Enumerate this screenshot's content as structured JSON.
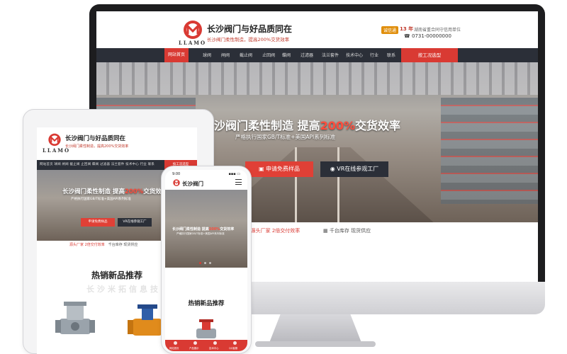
{
  "desktop": {
    "brand_word": "LLAMO",
    "title": "长沙阀门与好品质同在",
    "subtitle": "长沙阀门柔性制造，提高200%交货效率",
    "badge": "诚信通",
    "years": "13 年",
    "cert": "湖南省重合同守信用单位",
    "phone": "0731-00000000",
    "nav": [
      "网站首页",
      "球阀",
      "闸阀",
      "截止阀",
      "止回阀",
      "蝶阀",
      "过滤器",
      "法兰套件",
      "技术中心",
      "行业",
      "联系"
    ],
    "nav_cta": "按工况选型",
    "hero": {
      "title_a": "长沙阀门柔性制造 提高",
      "title_hl": "200%",
      "title_b": "交货效率",
      "sub": "严格执行国家GB/T标准+美国API系列标准",
      "btn_primary": "申请免费样品",
      "btn_secondary": "VR在线参观工厂"
    },
    "features": [
      {
        "a": "源头厂家",
        "b": "2倍交付效率"
      },
      {
        "a": "千台库存",
        "b": "现货供应"
      }
    ]
  },
  "tablet": {
    "brand_word": "LLAMO",
    "title": "长沙阀门与好品质同在",
    "subtitle": "长沙阀门柔性制造，提高200%交货效率",
    "nav_text": "网站首页  球阀  闸阀  截止阀  止回阀  蝶阀  过滤器  法兰套件  技术中心  行业  联系",
    "nav_cta": "按工况选型",
    "hero_title_a": "长沙阀门柔性制造 提高",
    "hero_title_hl": "200%",
    "hero_title_b": "交货效率",
    "hero_sub": "严格执行国家GB/T标准+美国API系列标准",
    "btn_primary": "申请免费样品",
    "btn_secondary": "VR在线参观工厂",
    "feat_a": "源头厂家 2倍交付效率",
    "feat_b": "千台库存 现货供应",
    "section_title": "热销新品推荐",
    "watermark": "长沙米拓信息技"
  },
  "phone": {
    "time": "9:00",
    "signal": "▪▪▪ ▭",
    "title": "长沙阀门",
    "hero_title_a": "长沙阀门柔性制造 提高",
    "hero_title_hl": "200%",
    "hero_title_b": "交货效率",
    "hero_sub": "严格执行国家GB/T标准+美国API系列标准",
    "section_title": "热销新品推荐",
    "tabs": [
      "网站首页",
      "产品展示",
      "技术中心",
      "QQ客服"
    ]
  },
  "colors": {
    "accent": "#d93a33",
    "nav_bg": "#2b2f38"
  }
}
